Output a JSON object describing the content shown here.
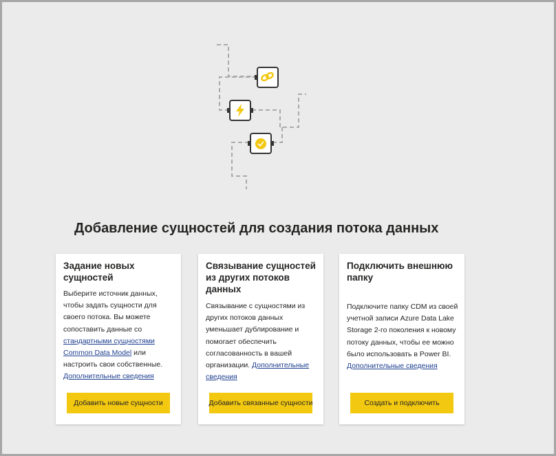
{
  "heading": "Добавление сущностей для создания потока данных",
  "cards": [
    {
      "title": "Задание новых сущностей",
      "text_1": "Выберите источник данных, чтобы задать сущности для своего потока. Вы можете сопоставить данные со",
      "link_standard": "стандартными сущностями Common Data Model",
      "text_2": "или настроить свои собственные.",
      "link_more": "Дополнительные сведения",
      "button": "Добавить новые сущности"
    },
    {
      "title": "Связывание сущностей из других потоков данных",
      "text_1": "Связывание с сущностями из других потоков данных уменьшает дублирование и помогает обеспечить согласованность в вашей организации.",
      "link_more": "Дополнительные сведения",
      "button": "Добавить связанные сущности"
    },
    {
      "title": "Подключить внешнюю папку",
      "text_1": "Подключите папку CDM из своей учетной записи Azure Data Lake Storage 2-го поколения к новому потоку данных, чтобы ее можно было использовать в Power BI.",
      "link_more": "Дополнительные сведения",
      "button": "Создать и подключить"
    }
  ],
  "illustration": {
    "icons": [
      "link-chain-icon",
      "lightning-bolt-icon",
      "certified-badge-icon"
    ]
  },
  "colors": {
    "accent": "#f2c811",
    "link": "#1e3f8f",
    "background": "#ebebeb",
    "border": "#a6a6a6"
  }
}
